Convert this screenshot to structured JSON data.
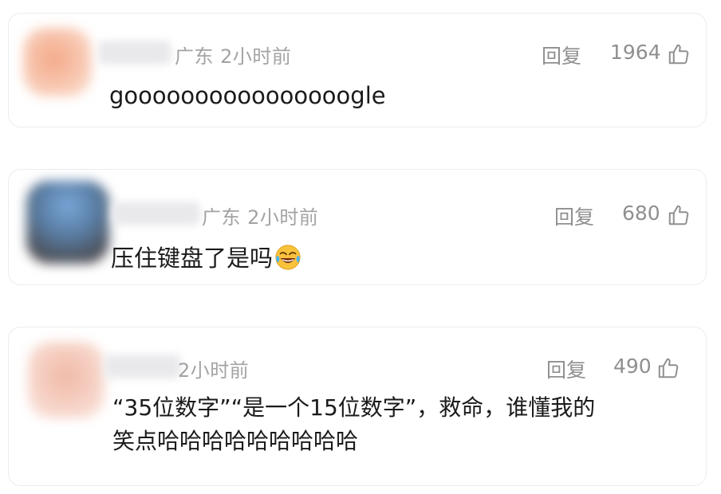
{
  "comments": [
    {
      "location": "广东",
      "time": "2小时前",
      "reply_label": "回复",
      "likes": "1964",
      "text": "goooooooooooooooogle",
      "avatar_color": "#f6c7ad"
    },
    {
      "location": "广东",
      "time": "2小时前",
      "reply_label": "回复",
      "likes": "680",
      "text": "压住键盘了是吗",
      "emoji": "face-with-tears-of-joy",
      "avatar_color": "#5b7fa8"
    },
    {
      "location": "",
      "time": "2小时前",
      "reply_label": "回复",
      "likes": "490",
      "text_line1": "“35位数字”“是一个15位数字”，救命，谁懂我的",
      "text_line2": "笑点哈哈哈哈哈哈哈哈哈",
      "avatar_color": "#f3d3c8"
    }
  ],
  "icons": {
    "like": "thumbs-up-icon",
    "emoji": "face-with-tears-of-joy"
  },
  "colors": {
    "meta_text": "#a3a3a3",
    "action_text": "#8f8f8f",
    "body_text": "#1a1a1a",
    "card_border": "#ececec"
  }
}
